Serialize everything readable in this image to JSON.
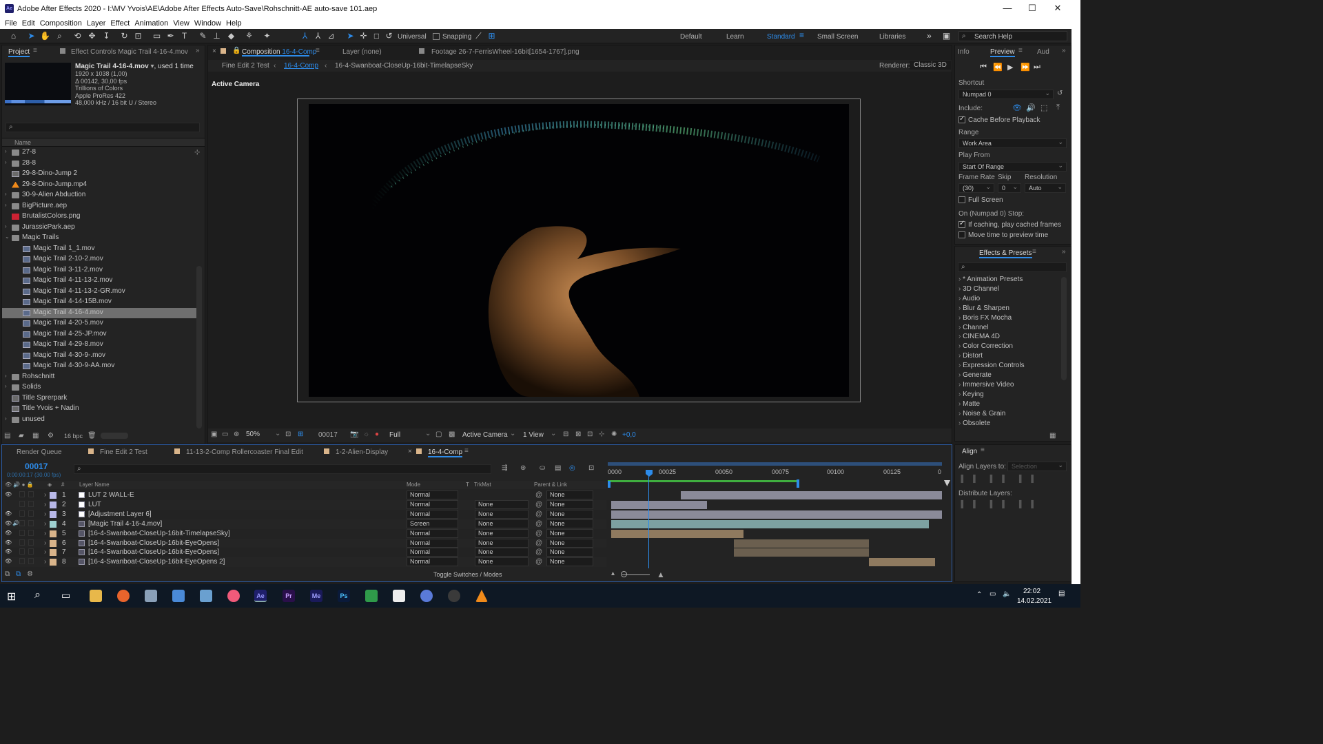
{
  "window": {
    "app_icon": "Ae",
    "title": "Adobe After Effects 2020 - I:\\MV Yvois\\AE\\Adobe After Effects Auto-Save\\Rohschnitt-AE auto-save 101.aep",
    "minimize": "—",
    "maximize": "☐",
    "close": "✕"
  },
  "menu": [
    "File",
    "Edit",
    "Composition",
    "Layer",
    "Effect",
    "Animation",
    "View",
    "Window",
    "Help"
  ],
  "toolbar": {
    "universal": "Universal",
    "snapping": "Snapping",
    "workspaces": [
      "Default",
      "Learn",
      "Standard",
      "Small Screen",
      "Libraries"
    ],
    "active_workspace": "Standard",
    "search_help": "Search Help"
  },
  "project": {
    "tab_project": "Project",
    "tab_effect_controls": "Effect Controls Magic Trail 4-16-4.mov",
    "info": {
      "name": "Magic Trail 4-16-4.mov",
      "used": ", used 1 time",
      "lines": [
        "1920 x 1038 (1,00)",
        "Δ 00142, 30,00 fps",
        "Trillions of Colors",
        "Apple ProRes 422",
        "48,000 kHz / 16 bit U / Stereo"
      ]
    },
    "column_name": "Name",
    "items": [
      {
        "label": "27-8",
        "type": "folder",
        "indent": 0,
        "arrow": "›"
      },
      {
        "label": "28-8",
        "type": "folder",
        "indent": 0,
        "arrow": "›"
      },
      {
        "label": "29-8-Dino-Jump 2",
        "type": "comp",
        "indent": 0,
        "arrow": ""
      },
      {
        "label": "29-8-Dino-Jump.mp4",
        "type": "vlc",
        "indent": 0,
        "arrow": ""
      },
      {
        "label": "30-9-Alien Abduction",
        "type": "folder",
        "indent": 0,
        "arrow": "›"
      },
      {
        "label": "BigPicture.aep",
        "type": "folder",
        "indent": 0,
        "arrow": "›"
      },
      {
        "label": "BrutalistColors.png",
        "type": "image",
        "indent": 0,
        "arrow": ""
      },
      {
        "label": "JurassicPark.aep",
        "type": "folder",
        "indent": 0,
        "arrow": "›"
      },
      {
        "label": "Magic Trails",
        "type": "folder",
        "indent": 0,
        "arrow": "⌄"
      },
      {
        "label": "Magic Trail 1_1.mov",
        "type": "file",
        "indent": 1,
        "arrow": ""
      },
      {
        "label": "Magic Trail 2-10-2.mov",
        "type": "file",
        "indent": 1,
        "arrow": ""
      },
      {
        "label": "Magic Trail 3-11-2.mov",
        "type": "file",
        "indent": 1,
        "arrow": ""
      },
      {
        "label": "Magic Trail 4-11-13-2.mov",
        "type": "file",
        "indent": 1,
        "arrow": ""
      },
      {
        "label": "Magic Trail 4-11-13-2-GR.mov",
        "type": "file",
        "indent": 1,
        "arrow": ""
      },
      {
        "label": "Magic Trail 4-14-15B.mov",
        "type": "file",
        "indent": 1,
        "arrow": ""
      },
      {
        "label": "Magic Trail 4-16-4.mov",
        "type": "file",
        "indent": 1,
        "arrow": "",
        "selected": true
      },
      {
        "label": "Magic Trail 4-20-5.mov",
        "type": "file",
        "indent": 1,
        "arrow": ""
      },
      {
        "label": "Magic Trail 4-25-JP.mov",
        "type": "file",
        "indent": 1,
        "arrow": ""
      },
      {
        "label": "Magic Trail 4-29-8.mov",
        "type": "file",
        "indent": 1,
        "arrow": ""
      },
      {
        "label": "Magic Trail 4-30-9-.mov",
        "type": "file",
        "indent": 1,
        "arrow": ""
      },
      {
        "label": "Magic Trail 4-30-9-AA.mov",
        "type": "file",
        "indent": 1,
        "arrow": ""
      },
      {
        "label": "Rohschnitt",
        "type": "folder",
        "indent": 0,
        "arrow": "›"
      },
      {
        "label": "Solids",
        "type": "folder",
        "indent": 0,
        "arrow": "›"
      },
      {
        "label": "Title Sprerpark",
        "type": "comp",
        "indent": 0,
        "arrow": ""
      },
      {
        "label": "Title Yvois + Nadin",
        "type": "comp",
        "indent": 0,
        "arrow": ""
      },
      {
        "label": "unused",
        "type": "folder",
        "indent": 0,
        "arrow": "›"
      }
    ],
    "bpc": "16 bpc"
  },
  "composition": {
    "tab_comp": "Composition",
    "tab_comp_name": "16-4-Comp",
    "tab_layer": "Layer (none)",
    "tab_footage": "Footage 26-7-FerrisWheel-16bit[1654-1767].png",
    "breadcrumbs": [
      "Fine Edit 2 Test",
      "16-4-Comp",
      "16-4-Swanboat-CloseUp-16bit-TimelapseSky"
    ],
    "renderer_label": "Renderer:",
    "renderer_value": "Classic 3D",
    "active_camera": "Active Camera",
    "bottom": {
      "zoom": "50%",
      "timecode": "00017",
      "resolution": "Full",
      "camera": "Active Camera",
      "views": "1 View",
      "exposure": "+0,0"
    }
  },
  "preview": {
    "tab_info": "Info",
    "tab_preview": "Preview",
    "tab_audio": "Aud",
    "shortcut_label": "Shortcut",
    "shortcut_value": "Numpad 0",
    "include_label": "Include:",
    "cache_before": "Cache Before Playback",
    "range_label": "Range",
    "range_value": "Work Area",
    "play_from_label": "Play From",
    "play_from_value": "Start Of Range",
    "frame_rate_label": "Frame Rate",
    "skip_label": "Skip",
    "resolution_label": "Resolution",
    "frame_rate_value": "(30)",
    "skip_value": "0",
    "resolution_value": "Auto",
    "full_screen": "Full Screen",
    "stop_label": "On (Numpad 0) Stop:",
    "if_caching": "If caching, play cached frames",
    "move_time": "Move time to preview time"
  },
  "effects": {
    "tab": "Effects & Presets",
    "items": [
      "* Animation Presets",
      "3D Channel",
      "Audio",
      "Blur & Sharpen",
      "Boris FX Mocha",
      "Channel",
      "CINEMA 4D",
      "Color Correction",
      "Distort",
      "Expression Controls",
      "Generate",
      "Immersive Video",
      "Keying",
      "Matte",
      "Noise & Grain",
      "Obsolete"
    ]
  },
  "align": {
    "tab": "Align",
    "align_to": "Align Layers to:",
    "align_to_value": "Selection",
    "distribute": "Distribute Layers:"
  },
  "timeline": {
    "tabs": [
      "Render Queue",
      "Fine Edit 2 Test",
      "11-13-2-Comp Rollercoaster Final Edit",
      "1-2-Alien-Display",
      "16-4-Comp"
    ],
    "timecode": "00017",
    "timecode_sub": "0:00:00:17 (30.00 fps)",
    "headers": {
      "num": "#",
      "name": "Layer Name",
      "mode": "Mode",
      "t": "T",
      "trkmat": "TrkMat",
      "parent": "Parent & Link"
    },
    "ruler": [
      "0000",
      "00025",
      "00050",
      "00075",
      "00100",
      "00125",
      "0"
    ],
    "layers": [
      {
        "n": "1",
        "name": "LUT 2 WALL-E",
        "mode": "Normal",
        "trk": "",
        "parent": "None",
        "color": "#b8b8e8",
        "eye": true,
        "audio": false,
        "bar_start": 0.21,
        "bar_end": 1.0,
        "bar_color": "#8a8a99"
      },
      {
        "n": "2",
        "name": "LUT",
        "mode": "Normal",
        "trk": "None",
        "parent": "None",
        "color": "#b8b8e8",
        "eye": false,
        "audio": false,
        "bar_start": 0.0,
        "bar_end": 0.29,
        "bar_color": "#8a8a99"
      },
      {
        "n": "3",
        "name": "[Adjustment Layer 6]",
        "mode": "Normal",
        "trk": "None",
        "parent": "None",
        "color": "#b8b8e8",
        "eye": true,
        "audio": false,
        "bar_start": 0.0,
        "bar_end": 1.0,
        "bar_color": "#8a8a99"
      },
      {
        "n": "4",
        "name": "[Magic Trail 4-16-4.mov]",
        "mode": "Screen",
        "trk": "None",
        "parent": "None",
        "color": "#9ed0d0",
        "eye": true,
        "audio": true,
        "bar_start": 0.0,
        "bar_end": 0.96,
        "bar_color": "#7da1a1"
      },
      {
        "n": "5",
        "name": "[16-4-Swanboat-CloseUp-16bit-TimelapseSky]",
        "mode": "Normal",
        "trk": "None",
        "parent": "None",
        "color": "#d9b48a",
        "eye": true,
        "audio": false,
        "bar_start": 0.0,
        "bar_end": 0.4,
        "bar_color": "#8f7a5f"
      },
      {
        "n": "6",
        "name": "[16-4-Swanboat-CloseUp-16bit-EyeOpens]",
        "mode": "Normal",
        "trk": "None",
        "parent": "None",
        "color": "#d9b48a",
        "eye": true,
        "audio": false,
        "bar_start": 0.37,
        "bar_end": 0.78,
        "bar_color": "#6b5f4f"
      },
      {
        "n": "7",
        "name": "[16-4-Swanboat-CloseUp-16bit-EyeOpens]",
        "mode": "Normal",
        "trk": "None",
        "parent": "None",
        "color": "#d9b48a",
        "eye": true,
        "audio": false,
        "bar_start": 0.37,
        "bar_end": 0.78,
        "bar_color": "#6b5f4f"
      },
      {
        "n": "8",
        "name": "[16-4-Swanboat-CloseUp-16bit-EyeOpens 2]",
        "mode": "Normal",
        "trk": "None",
        "parent": "None",
        "color": "#d9b48a",
        "eye": true,
        "audio": false,
        "bar_start": 0.78,
        "bar_end": 0.98,
        "bar_color": "#8f7a5f"
      }
    ],
    "toggle": "Toggle Switches / Modes"
  },
  "taskbar": {
    "time": "22:02",
    "date": "14.02.2021",
    "apps": [
      "Ae",
      "Pr",
      "Me",
      "Ps"
    ]
  }
}
